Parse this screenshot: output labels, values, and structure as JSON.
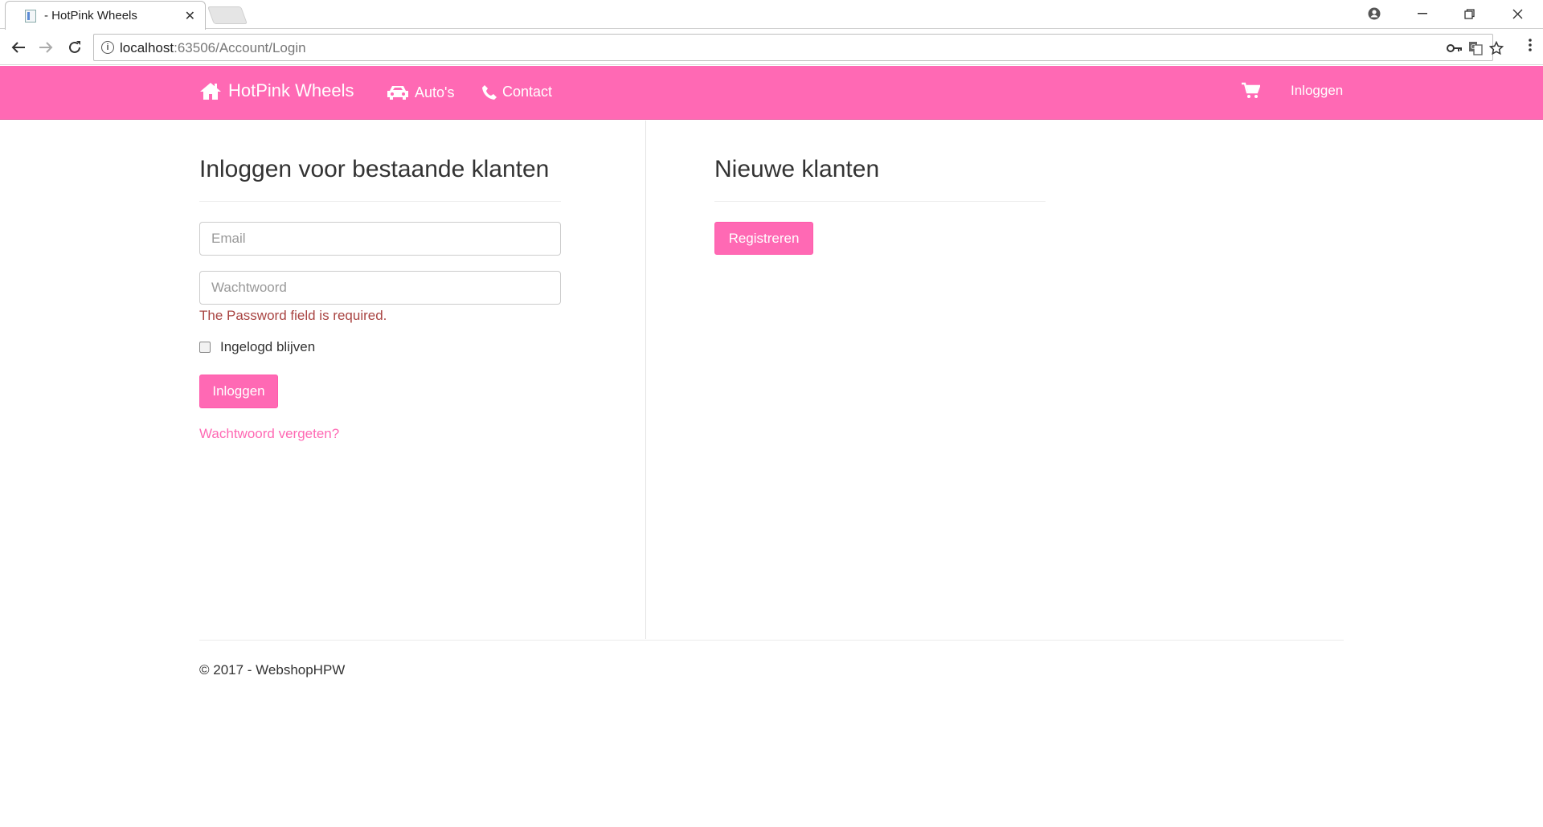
{
  "browser": {
    "tab_title": "- HotPink Wheels",
    "url_host": "localhost",
    "url_rest": ":63506/Account/Login"
  },
  "nav": {
    "brand": "HotPink Wheels",
    "links": [
      {
        "label": "Auto's",
        "icon": "car-icon"
      },
      {
        "label": "Contact",
        "icon": "phone-icon"
      }
    ],
    "cart_icon": "shopping-cart-icon",
    "login": "Inloggen"
  },
  "login_section": {
    "heading": "Inloggen voor bestaande klanten",
    "email_placeholder": "Email",
    "password_placeholder": "Wachtwoord",
    "password_error": "The Password field is required.",
    "remember_label": "Ingelogd blijven",
    "submit_label": "Inloggen",
    "forgot_link": "Wachtwoord vergeten?"
  },
  "register_section": {
    "heading": "Nieuwe klanten",
    "button_label": "Registreren"
  },
  "footer": {
    "text": "© 2017 - WebshopHPW"
  },
  "colors": {
    "accent": "#ff69b4",
    "error": "#a94442"
  }
}
